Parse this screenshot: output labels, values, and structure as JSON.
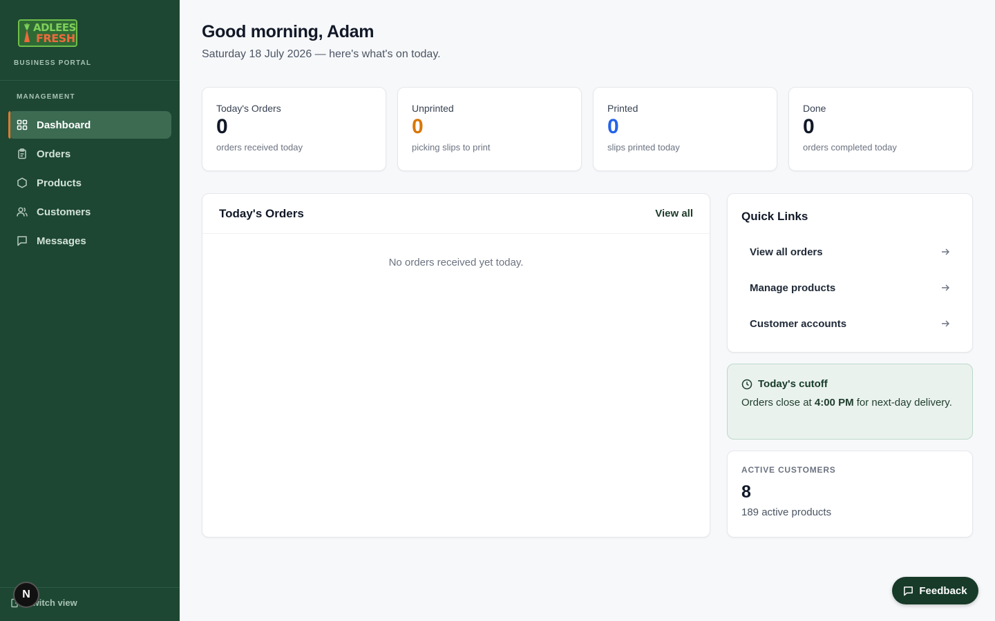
{
  "brand": {
    "logo_line1": "ADLEES",
    "logo_line2": "FRESH",
    "portal_label": "BUSINESS PORTAL"
  },
  "sidebar": {
    "section_label": "MANAGEMENT",
    "items": [
      {
        "label": "Dashboard",
        "icon": "dashboard-grid-icon",
        "active": true
      },
      {
        "label": "Orders",
        "icon": "clipboard-icon",
        "active": false
      },
      {
        "label": "Products",
        "icon": "hexagon-box-icon",
        "active": false
      },
      {
        "label": "Customers",
        "icon": "users-icon",
        "active": false
      },
      {
        "label": "Messages",
        "icon": "chat-bubble-icon",
        "active": false
      }
    ],
    "switch_view": "Switch view",
    "badge": "N"
  },
  "header": {
    "greeting": "Good morning, Adam",
    "subtitle": "Saturday 18 July 2026 — here's what's on today."
  },
  "stats": [
    {
      "label": "Today's Orders",
      "value": "0",
      "hint": "orders received today",
      "color": "#111827"
    },
    {
      "label": "Unprinted",
      "value": "0",
      "hint": "picking slips to print",
      "color": "#d97706"
    },
    {
      "label": "Printed",
      "value": "0",
      "hint": "slips printed today",
      "color": "#2563eb"
    },
    {
      "label": "Done",
      "value": "0",
      "hint": "orders completed today",
      "color": "#111827"
    }
  ],
  "orders_panel": {
    "title": "Today's Orders",
    "view_all": "View all",
    "empty": "No orders received yet today."
  },
  "quick_links": {
    "title": "Quick Links",
    "items": [
      {
        "label": "View all orders"
      },
      {
        "label": "Manage products"
      },
      {
        "label": "Customer accounts"
      }
    ]
  },
  "cutoff": {
    "title": "Today's cutoff",
    "text_before": "Orders close at ",
    "time": "4:00 PM",
    "text_after": " for next-day delivery."
  },
  "active_customers": {
    "label": "ACTIVE CUSTOMERS",
    "value": "8",
    "sub": "189 active products"
  },
  "feedback_label": "Feedback",
  "colors": {
    "sidebar_bg": "#1d4732",
    "accent_orange": "#d97706",
    "accent_blue": "#2563eb",
    "brand_dark": "#173a29"
  }
}
